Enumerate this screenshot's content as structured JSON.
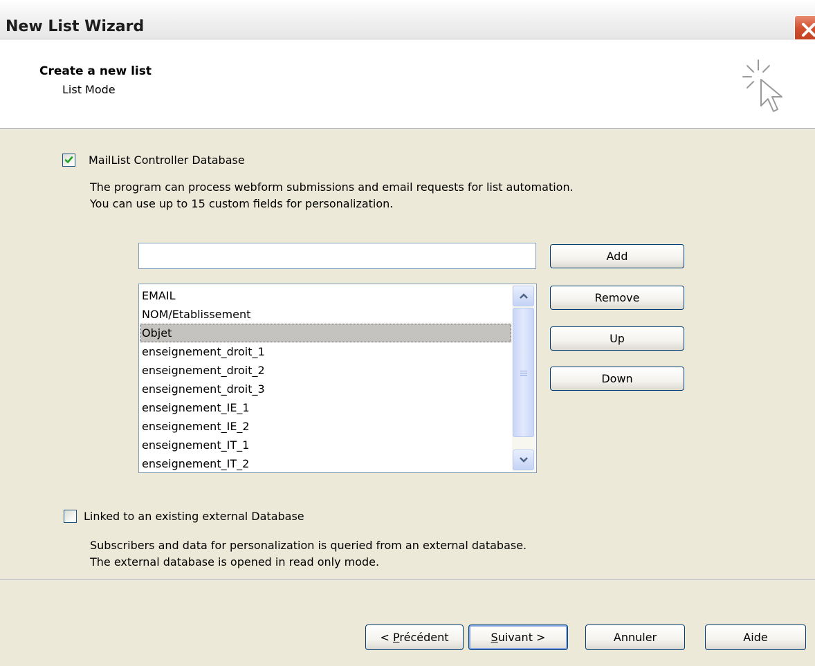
{
  "window": {
    "title": "New List Wizard"
  },
  "header": {
    "title": "Create a new list",
    "subtitle": "List Mode"
  },
  "option_internal": {
    "checked": true,
    "label": "MailList Controller Database",
    "desc_line1": "The program can process webform submissions and email requests for list automation.",
    "desc_line2": "You can use up to 15 custom fields for personalization."
  },
  "field_editor": {
    "input_value": "",
    "buttons": {
      "add": "Add",
      "remove": "Remove",
      "up": "Up",
      "down": "Down"
    },
    "fields": [
      "EMAIL",
      "NOM/Etablissement",
      "Objet",
      "enseignement_droit_1",
      "enseignement_droit_2",
      "enseignement_droit_3",
      "enseignement_IE_1",
      "enseignement_IE_2",
      "enseignement_IT_1",
      "enseignement_IT_2"
    ],
    "selected_field": "Objet"
  },
  "option_external": {
    "checked": false,
    "label": "Linked to an existing external Database",
    "desc_line1": "Subscribers and data for personalization is queried from an external database.",
    "desc_line2": "The external database is opened in read only mode."
  },
  "footer": {
    "back": {
      "prefix": "< ",
      "mnemonic": "P",
      "rest": "récédent"
    },
    "next": {
      "mnemonic": "S",
      "rest": "uivant >"
    },
    "cancel": "Annuler",
    "help": "Aide"
  }
}
